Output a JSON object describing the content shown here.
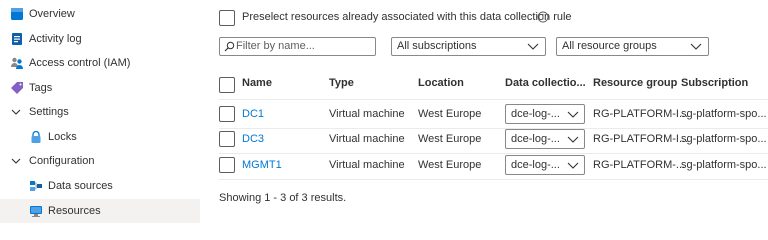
{
  "sidebar": {
    "items": [
      {
        "label": "Overview"
      },
      {
        "label": "Activity log"
      },
      {
        "label": "Access control (IAM)"
      },
      {
        "label": "Tags"
      },
      {
        "label": "Settings"
      },
      {
        "label": "Locks"
      },
      {
        "label": "Configuration"
      },
      {
        "label": "Data sources"
      },
      {
        "label": "Resources"
      }
    ]
  },
  "main": {
    "preselect_label": "Preselect resources already associated with this data collection rule",
    "filter_placeholder": "Filter by name...",
    "subscriptions_value": "All subscriptions",
    "resource_groups_value": "All resource groups",
    "columns": [
      "Name",
      "Type",
      "Location",
      "Data collectio...",
      "Resource group",
      "Subscription"
    ],
    "rows": [
      {
        "name": "DC1",
        "type": "Virtual machine",
        "location": "West Europe",
        "dce": "dce-log-...",
        "resource_group": "RG-PLATFORM-I...",
        "subscription": "sg-platform-spo..."
      },
      {
        "name": "DC3",
        "type": "Virtual machine",
        "location": "West Europe",
        "dce": "dce-log-...",
        "resource_group": "RG-PLATFORM-I...",
        "subscription": "sg-platform-spo..."
      },
      {
        "name": "MGMT1",
        "type": "Virtual machine",
        "location": "West Europe",
        "dce": "dce-log-...",
        "resource_group": "RG-PLATFORM-...",
        "subscription": "sg-platform-spo..."
      }
    ],
    "results_text": "Showing 1 - 3 of 3 results."
  },
  "colors": {
    "accent": "#0078d4",
    "selected_bg": "#f3f2f1"
  }
}
